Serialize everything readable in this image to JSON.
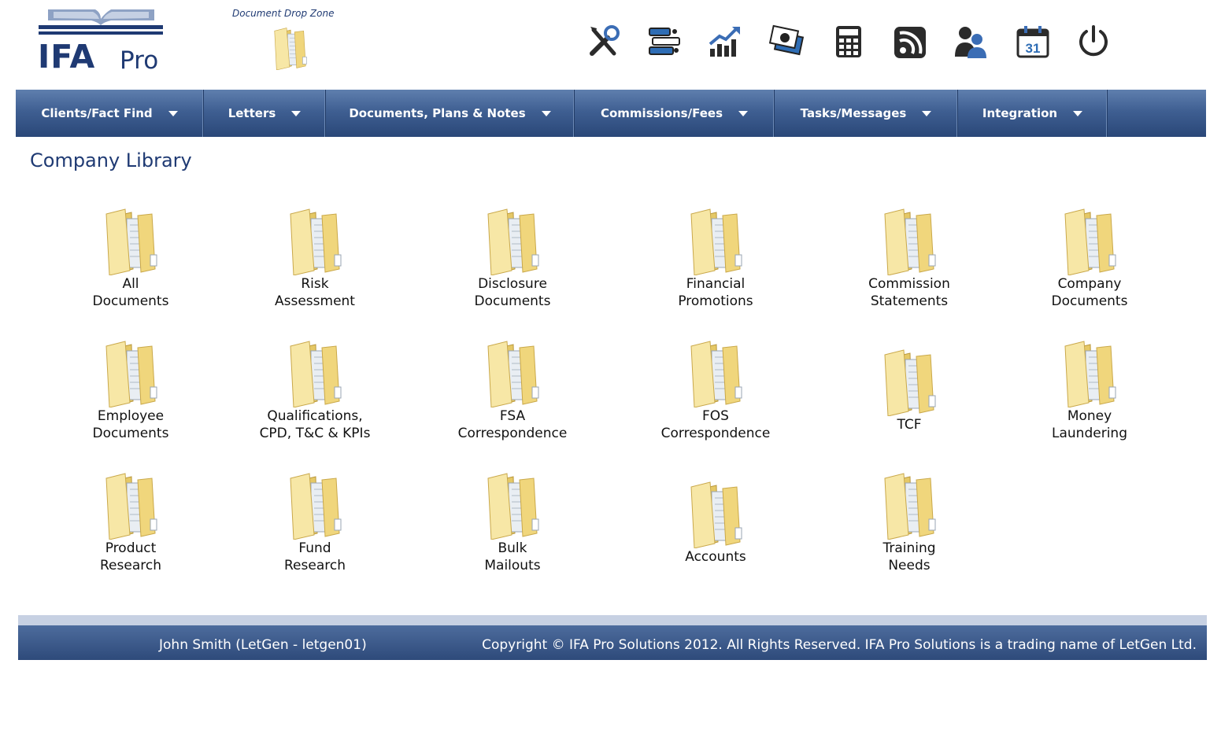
{
  "logo": {
    "ifa": "IFA",
    "pro": "Pro"
  },
  "dropzone": {
    "label": "Document Drop Zone",
    "icon": "folder-icon"
  },
  "toolbar": [
    {
      "icon": "tools-icon"
    },
    {
      "icon": "filing-icon"
    },
    {
      "icon": "chart-growth-icon"
    },
    {
      "icon": "money-icon"
    },
    {
      "icon": "calculator-icon"
    },
    {
      "icon": "rss-feed-icon"
    },
    {
      "icon": "users-icon"
    },
    {
      "icon": "calendar-icon",
      "day": "31"
    },
    {
      "icon": "power-icon"
    }
  ],
  "nav": [
    {
      "label": "Clients/Fact Find"
    },
    {
      "label": "Letters"
    },
    {
      "label": "Documents, Plans & Notes"
    },
    {
      "label": "Commissions/Fees"
    },
    {
      "label": "Tasks/Messages"
    },
    {
      "label": "Integration"
    }
  ],
  "page": {
    "title": "Company Library"
  },
  "folders": [
    {
      "label": "All\nDocuments"
    },
    {
      "label": "Risk\nAssessment"
    },
    {
      "label": "Disclosure\nDocuments"
    },
    {
      "label": "Financial\nPromotions"
    },
    {
      "label": "Commission\nStatements"
    },
    {
      "label": "Company\nDocuments"
    },
    {
      "label": "Employee\nDocuments"
    },
    {
      "label": "Qualifications,\nCPD, T&C & KPIs"
    },
    {
      "label": "FSA\nCorrespondence"
    },
    {
      "label": "FOS\nCorrespondence"
    },
    {
      "label": "TCF"
    },
    {
      "label": "Money\nLaundering"
    },
    {
      "label": "Product\nResearch"
    },
    {
      "label": "Fund\nResearch"
    },
    {
      "label": "Bulk\nMailouts"
    },
    {
      "label": "Accounts"
    },
    {
      "label": "Training\nNeeds"
    }
  ],
  "footer": {
    "user": "John Smith (LetGen - letgen01)",
    "copyright": "Copyright © IFA Pro Solutions 2012. All Rights Reserved. IFA Pro Solutions is a trading name of LetGen Ltd."
  },
  "colors": {
    "brand": "#1f3a73",
    "nav": "#3f5f92",
    "folder": "#f2dc8c"
  }
}
